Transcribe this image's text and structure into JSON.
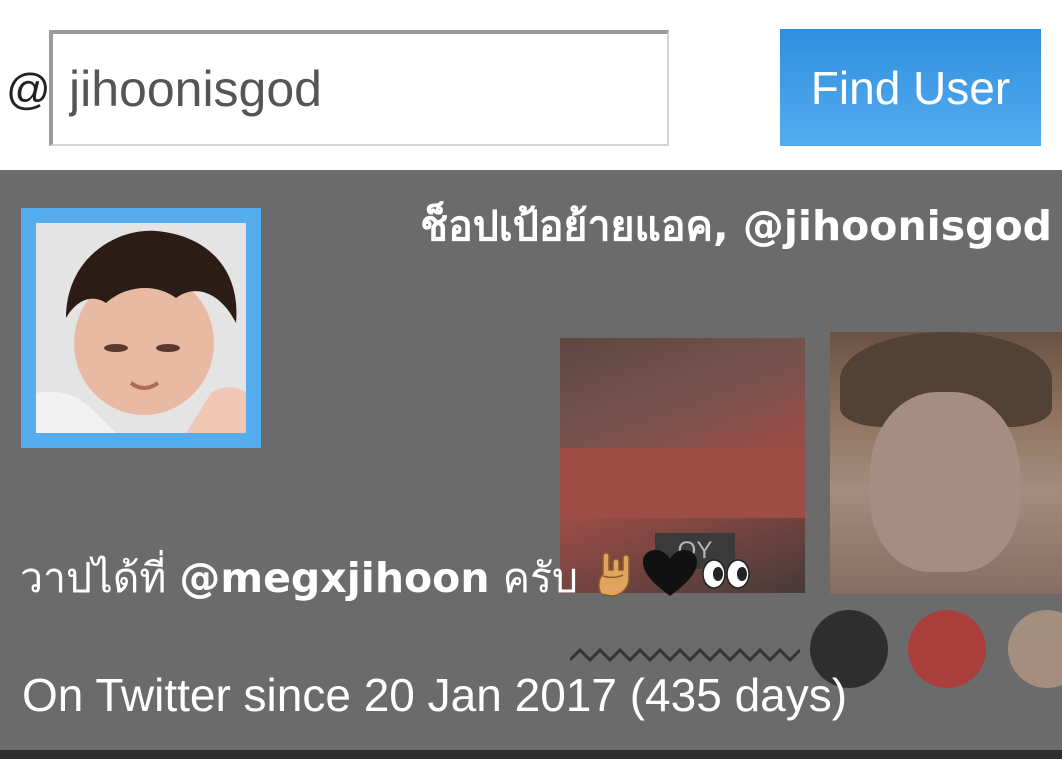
{
  "search": {
    "prefix": "@",
    "value": "jihoonisgod",
    "button_label": "Find User"
  },
  "profile": {
    "display_name": "ช็อปเป้อย้ายแอค",
    "name_separator": ", ",
    "handle": "@jihoonisgod",
    "bio": {
      "before": "วาปได้ที่ ",
      "mention": "@megxjihoon",
      "after": " ครับ "
    },
    "since": "On Twitter since 20 Jan 2017 (435 days)"
  },
  "colors": {
    "accent": "#55acee",
    "button_top": "#2f8fe0",
    "card_bg": "#6b6b6b",
    "text_on_card": "#ffffff"
  },
  "icons": [
    "rock-hand-emoji-icon",
    "black-heart-emoji-icon",
    "eyes-emoji-icon"
  ]
}
